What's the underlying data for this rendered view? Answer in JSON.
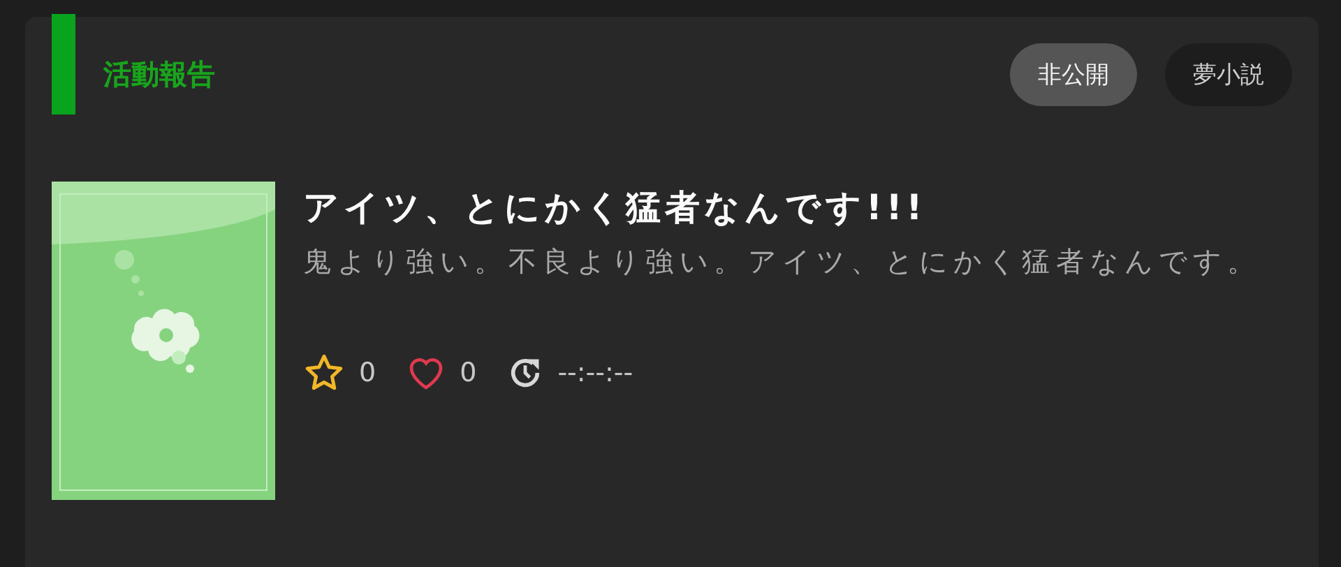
{
  "section": {
    "title": "活動報告"
  },
  "tags": [
    {
      "label": "非公開",
      "kind": "status"
    },
    {
      "label": "夢小説",
      "kind": "genre"
    }
  ],
  "entry": {
    "title": "アイツ、とにかく猛者なんです!!!",
    "description": "鬼より強い。不良より強い。アイツ、とにかく猛者なんです。",
    "stars_count": "0",
    "likes_count": "0",
    "updated": "--:--:--"
  }
}
